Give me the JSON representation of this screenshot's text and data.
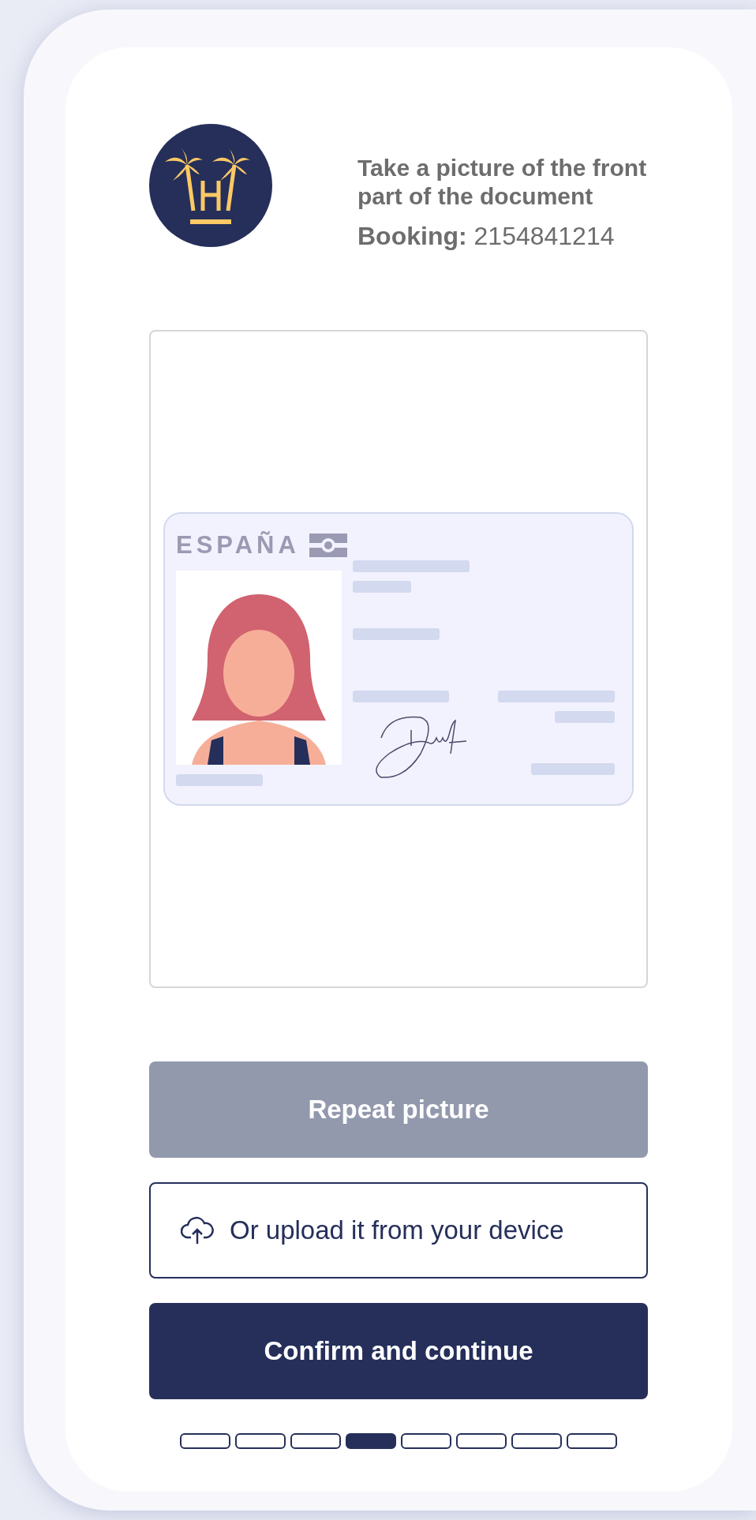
{
  "header": {
    "title": "Take a picture of the front part of the document",
    "booking_label": "Booking:",
    "booking_number": "2154841214"
  },
  "id_card": {
    "country": "ESPAÑA"
  },
  "buttons": [
    {
      "kind": "secondary",
      "label": "Repeat picture"
    },
    {
      "kind": "upload",
      "label": "Or upload it from your device"
    },
    {
      "kind": "primary",
      "label": "Confirm and continue"
    }
  ],
  "steps": [
    {
      "selected": false
    },
    {
      "selected": false
    },
    {
      "selected": false
    },
    {
      "selected": true
    },
    {
      "selected": false
    },
    {
      "selected": false
    },
    {
      "selected": false
    },
    {
      "selected": false
    }
  ]
}
